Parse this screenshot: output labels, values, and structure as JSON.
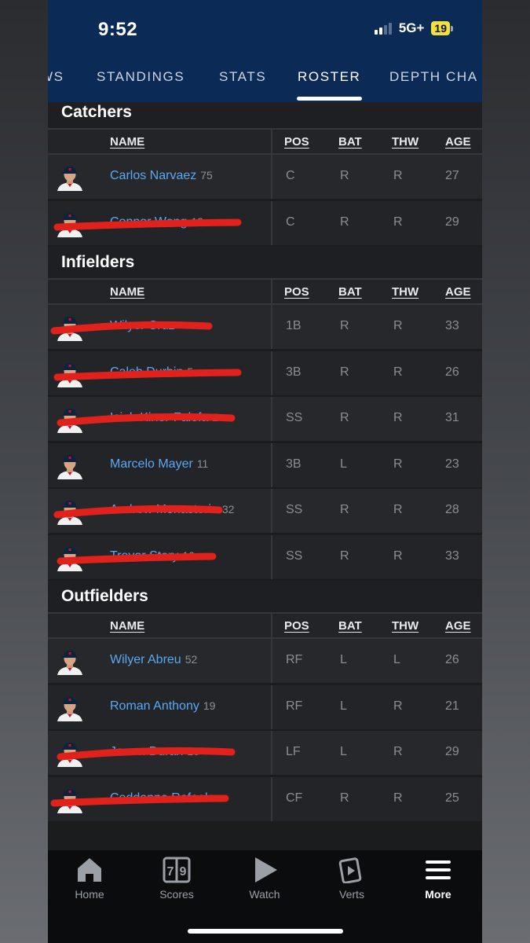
{
  "status_bar": {
    "time": "9:52",
    "network": "5G+",
    "battery": "19"
  },
  "tabs": [
    {
      "label": "WS"
    },
    {
      "label": "STANDINGS"
    },
    {
      "label": "STATS"
    },
    {
      "label": "ROSTER",
      "active": true
    },
    {
      "label": "DEPTH CHA"
    }
  ],
  "table_header": {
    "name": "NAME",
    "pos": "POS",
    "bat": "BAT",
    "thw": "THW",
    "age": "AGE"
  },
  "sections": [
    {
      "title": "Catchers",
      "players": [
        {
          "name": "Carlos Narvaez",
          "number": "75",
          "pos": "C",
          "bat": "R",
          "thw": "R",
          "age": "27",
          "redacted": false
        },
        {
          "name": "Connor Wong",
          "number": "12",
          "pos": "C",
          "bat": "R",
          "thw": "R",
          "age": "29",
          "redacted": true
        }
      ]
    },
    {
      "title": "Infielders",
      "players": [
        {
          "name": "Wilyer Cruz",
          "number": "",
          "pos": "1B",
          "bat": "R",
          "thw": "R",
          "age": "33",
          "redacted": true
        },
        {
          "name": "Caleb Durbin",
          "number": "5",
          "pos": "3B",
          "bat": "R",
          "thw": "R",
          "age": "26",
          "redacted": true
        },
        {
          "name": "Isiah Kiner-Falefa",
          "number": "2",
          "pos": "SS",
          "bat": "R",
          "thw": "R",
          "age": "31",
          "redacted": true
        },
        {
          "name": "Marcelo Mayer",
          "number": "11",
          "pos": "3B",
          "bat": "L",
          "thw": "R",
          "age": "23",
          "redacted": false
        },
        {
          "name": "Andrew Monasterio",
          "number": "32",
          "pos": "SS",
          "bat": "R",
          "thw": "R",
          "age": "28",
          "redacted": true
        },
        {
          "name": "Trevor Story",
          "number": "10",
          "pos": "SS",
          "bat": "R",
          "thw": "R",
          "age": "33",
          "redacted": true
        }
      ]
    },
    {
      "title": "Outfielders",
      "players": [
        {
          "name": "Wilyer Abreu",
          "number": "52",
          "pos": "RF",
          "bat": "L",
          "thw": "L",
          "age": "26",
          "redacted": false
        },
        {
          "name": "Roman Anthony",
          "number": "19",
          "pos": "RF",
          "bat": "L",
          "thw": "R",
          "age": "21",
          "redacted": false
        },
        {
          "name": "Jarren Duran",
          "number": "16",
          "pos": "LF",
          "bat": "L",
          "thw": "R",
          "age": "29",
          "redacted": true
        },
        {
          "name": "Ceddanne Rafaela",
          "number": "",
          "pos": "CF",
          "bat": "R",
          "thw": "R",
          "age": "25",
          "redacted": true
        }
      ]
    }
  ],
  "bottom_nav": [
    {
      "label": "Home",
      "icon": "home-icon"
    },
    {
      "label": "Scores",
      "icon": "scoreboard-icon"
    },
    {
      "label": "Watch",
      "icon": "play-icon"
    },
    {
      "label": "Verts",
      "icon": "verts-icon"
    },
    {
      "label": "More",
      "icon": "menu-icon",
      "active": true
    }
  ],
  "colors": {
    "header_bg": "#0b2a55",
    "player_link": "#5ba8f3",
    "redaction": "#e0211c",
    "battery_fill": "#f3e03a"
  }
}
